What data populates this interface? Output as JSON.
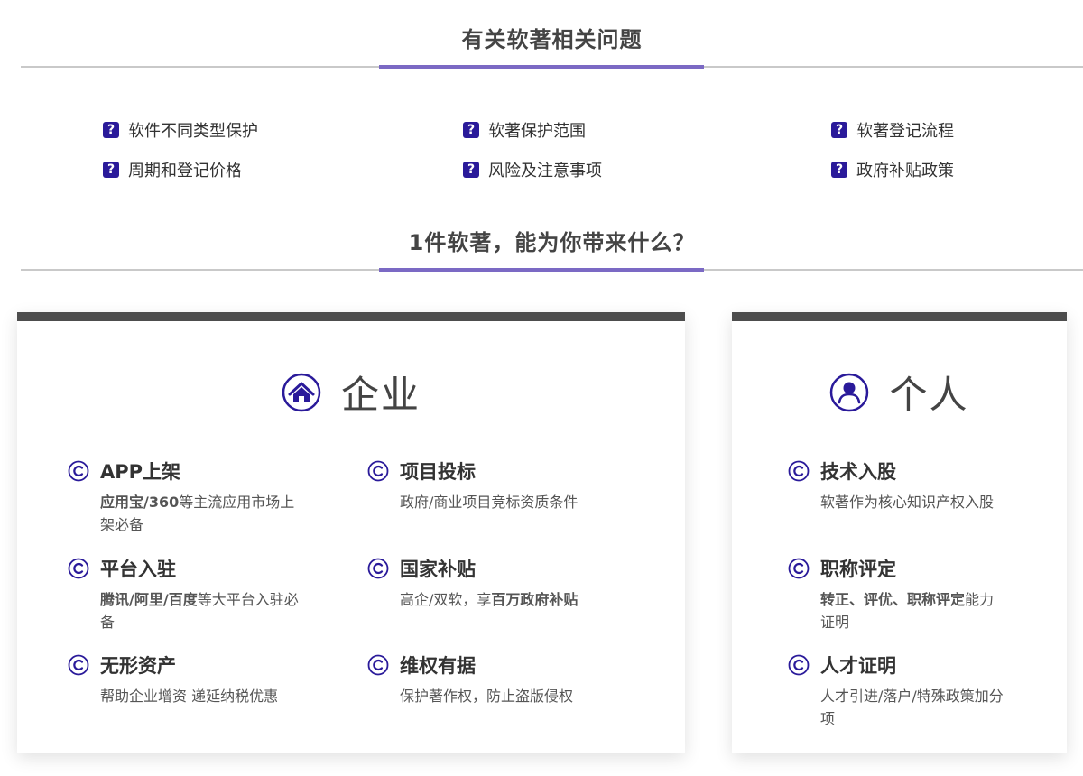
{
  "faq_section": {
    "title": "有关软著相关问题",
    "items": [
      "软件不同类型保护",
      "软著保护范围",
      "软著登记流程",
      "周期和登记价格",
      "风险及注意事项",
      "政府补贴政策"
    ]
  },
  "benefits_section": {
    "title": "1件软著，能为你带来什么？"
  },
  "enterprise": {
    "title": "企业",
    "features": [
      {
        "title": "APP上架",
        "desc_bold": "应用宝/360",
        "desc_rest": "等主流应用市场上架必备"
      },
      {
        "title": "项目投标",
        "desc_bold": "",
        "desc_rest": "政府/商业项目竞标资质条件"
      },
      {
        "title": "平台入驻",
        "desc_bold": "腾讯/阿里/百度",
        "desc_rest": "等大平台入驻必备"
      },
      {
        "title": "国家补贴",
        "desc_rest": "高企/双软，享",
        "desc_bold": "百万政府补贴"
      },
      {
        "title": "无形资产",
        "desc_bold": "",
        "desc_rest": "帮助企业增资 递延纳税优惠"
      },
      {
        "title": "维权有据",
        "desc_bold": "",
        "desc_rest": "保护著作权，防止盗版侵权"
      }
    ]
  },
  "personal": {
    "title": "个人",
    "features": [
      {
        "title": "技术入股",
        "desc_bold": "",
        "desc_rest": "软著作为核心知识产权入股"
      },
      {
        "title": "职称评定",
        "desc_bold": "转正、评优、职称评定",
        "desc_rest": "能力证明"
      },
      {
        "title": "人才证明",
        "desc_bold": "",
        "desc_rest": "人才引进/落户/特殊政策加分项"
      }
    ]
  },
  "colors": {
    "accent": "#7b69c4",
    "icon": "#2a1a9a",
    "card_bar": "#4d4d4d"
  },
  "icons": {
    "faq": "question-icon",
    "enterprise": "home-circle-icon",
    "personal": "user-circle-icon",
    "feature": "copyright-icon"
  }
}
